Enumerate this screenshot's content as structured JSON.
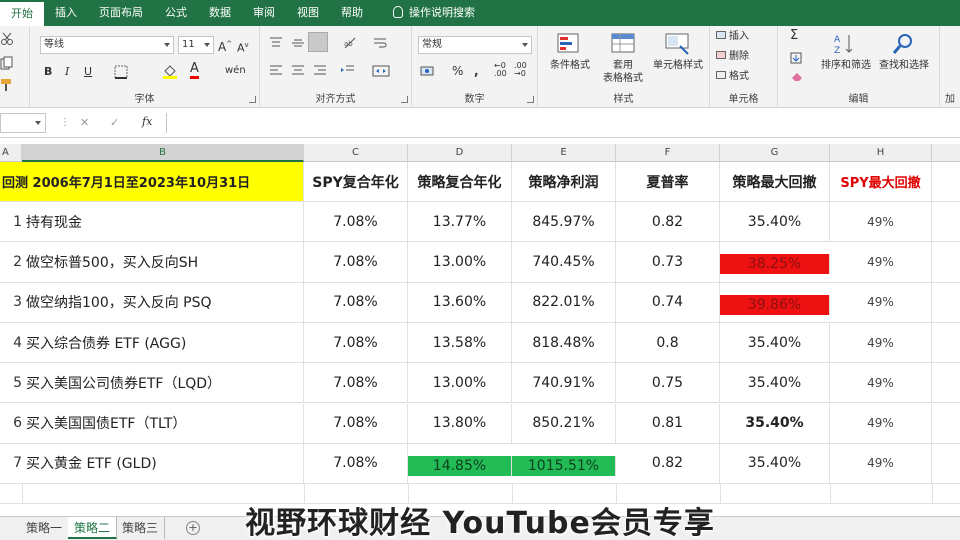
{
  "tabs": [
    {
      "label": "开始",
      "active": true
    },
    {
      "label": "插入"
    },
    {
      "label": "页面布局"
    },
    {
      "label": "公式"
    },
    {
      "label": "数据"
    },
    {
      "label": "审阅"
    },
    {
      "label": "视图"
    },
    {
      "label": "帮助"
    },
    {
      "label": "操作说明搜索",
      "icon": "lightbulb-icon"
    }
  ],
  "ribbon": {
    "font_name": "等线",
    "font_size": "11",
    "number_format": "常规",
    "groups": {
      "font": "字体",
      "alignment": "对齐方式",
      "number": "数字",
      "styles": "样式",
      "cells": "单元格",
      "editing": "编辑",
      "addins": "加"
    },
    "styles_buttons": {
      "conditional": "条件格式",
      "table1": "套用",
      "table2": "表格格式",
      "cellstyle": "单元格样式"
    },
    "cells_buttons": {
      "insert": "插入",
      "delete": "删除",
      "format": "格式"
    },
    "editing_buttons": {
      "sort": "排序和筛选",
      "find": "查找和选择"
    },
    "font_buttons": {
      "bold": "B",
      "italic": "I",
      "underline": "U"
    }
  },
  "formula_bar": {
    "fx": "fx",
    "cancel": "✕",
    "enter": "✓"
  },
  "columns": [
    "A",
    "B",
    "C",
    "D",
    "E",
    "F",
    "G",
    "H"
  ],
  "header_row": {
    "title": "回测 2006年7月1日至2023年10月31日",
    "cols": [
      "SPY复合年化",
      "策略复合年化",
      "策略净利润",
      "夏普率",
      "策略最大回撤",
      "SPY最大回撤"
    ]
  },
  "rows": [
    {
      "n": "1",
      "name": "持有现金",
      "c": "7.08%",
      "d": "13.77%",
      "e": "845.97%",
      "f": "0.82",
      "g": "35.40%",
      "h": "49%"
    },
    {
      "n": "2",
      "name": "做空标普500，买入反向SH",
      "c": "7.08%",
      "d": "13.00%",
      "e": "740.45%",
      "f": "0.73",
      "g": "38.25%",
      "h": "49%"
    },
    {
      "n": "3",
      "name": "做空纳指100，买入反向 PSQ",
      "c": "7.08%",
      "d": "13.60%",
      "e": "822.01%",
      "f": "0.74",
      "g": "39.86%",
      "h": "49%"
    },
    {
      "n": "4",
      "name": "买入综合债券 ETF (AGG)",
      "c": "7.08%",
      "d": "13.58%",
      "e": "818.48%",
      "f": "0.8",
      "g": "35.40%",
      "h": "49%"
    },
    {
      "n": "5",
      "name": "买入美国公司债券ETF（LQD）",
      "c": "7.08%",
      "d": "13.00%",
      "e": "740.91%",
      "f": "0.75",
      "g": "35.40%",
      "h": "49%"
    },
    {
      "n": "6",
      "name": "买入美国国债ETF（TLT）",
      "c": "7.08%",
      "d": "13.80%",
      "e": "850.21%",
      "f": "0.81",
      "g": "35.40%",
      "h": "49%"
    },
    {
      "n": "7",
      "name": "买入黄金 ETF (GLD)",
      "c": "7.08%",
      "d": "14.85%",
      "e": "1015.51%",
      "f": "0.82",
      "g": "35.40%",
      "h": "49%"
    }
  ],
  "colors": {
    "excel_green": "#217346",
    "header_yellow": "#ffff00",
    "red_fill": "#ee1111",
    "green_fill": "#22bb55",
    "spy_red": "#e00000"
  },
  "sheets": [
    {
      "label": "策略一"
    },
    {
      "label": "策略二",
      "active": true
    },
    {
      "label": "策略三"
    }
  ],
  "add_sheet": "+",
  "watermark": "视野环球财经 YouTube会员专享"
}
